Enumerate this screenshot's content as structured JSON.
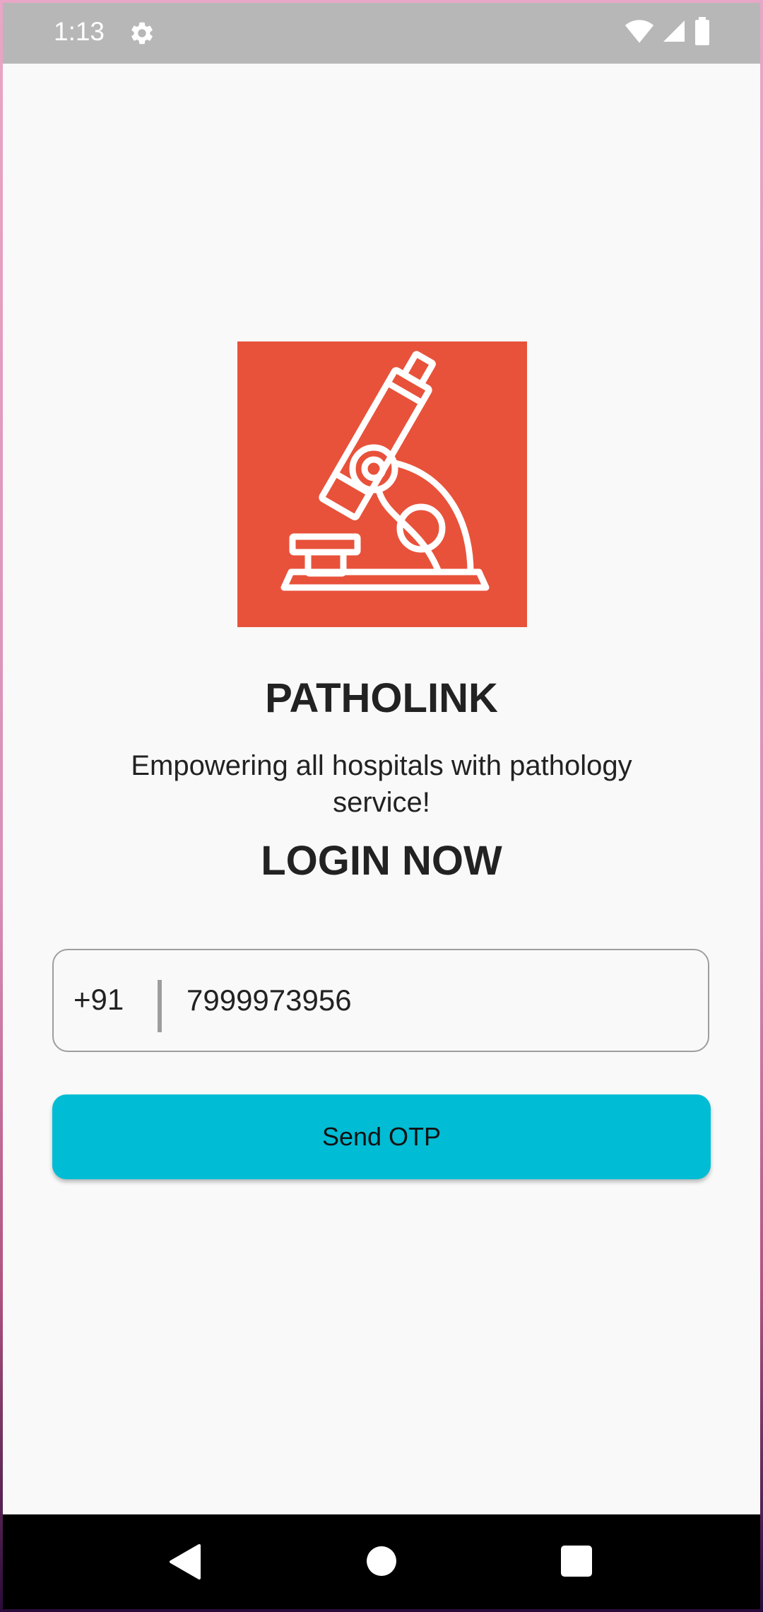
{
  "status_bar": {
    "time": "1:13",
    "icons": [
      "gear-icon",
      "wifi-icon",
      "cellular-signal-icon",
      "battery-icon"
    ]
  },
  "logo": {
    "icon": "microscope-icon",
    "background_color": "#e8523a"
  },
  "app": {
    "title": "PATHOLINK",
    "tagline": "Empowering all hospitals with pathology service!"
  },
  "login": {
    "heading": "LOGIN NOW",
    "country_code": "+91",
    "phone_value": "7999973956",
    "send_button_label": "Send OTP",
    "button_color": "#00bcd4"
  },
  "nav_bar": {
    "icons": [
      "back-icon",
      "home-icon",
      "recents-icon"
    ]
  }
}
